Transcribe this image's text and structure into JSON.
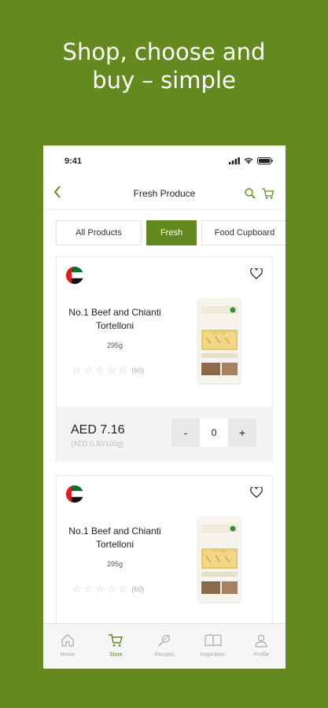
{
  "headline": {
    "line1": "Shop, choose and",
    "line2": "buy – simple"
  },
  "status_bar": {
    "time": "9:41"
  },
  "header": {
    "title": "Fresh Produce"
  },
  "tabs": [
    {
      "label": "All Products",
      "active": false
    },
    {
      "label": "Fresh",
      "active": true
    },
    {
      "label": "Food Cupboard",
      "active": false
    }
  ],
  "products": [
    {
      "name": "No.1 Beef and Chianti Tortelloni",
      "weight": "295g",
      "rating": 0,
      "review_count": "(60)",
      "price": "AED 7.16",
      "unit_price": "(AED 0.30/100g)",
      "quantity": "0",
      "minus_label": "-",
      "plus_label": "+"
    },
    {
      "name": "No.1 Beef and Chianti Tortelloni",
      "weight": "295g",
      "rating": 0,
      "review_count": "(60)"
    }
  ],
  "bottom_nav": [
    {
      "label": "Home",
      "icon": "home-icon",
      "active": false
    },
    {
      "label": "Store",
      "icon": "cart-icon",
      "active": true
    },
    {
      "label": "Recipes",
      "icon": "whisk-icon",
      "active": false
    },
    {
      "label": "Inspiration",
      "icon": "book-icon",
      "active": false
    },
    {
      "label": "Profile",
      "icon": "person-icon",
      "active": false
    }
  ],
  "colors": {
    "brand_green": "#63891f",
    "background": "#63891f"
  }
}
